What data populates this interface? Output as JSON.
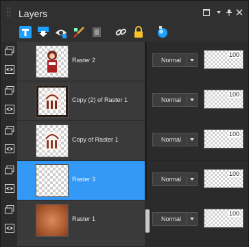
{
  "panel": {
    "title": "Layers"
  },
  "toolbar": {
    "icons": [
      "new-raster-layer-icon",
      "merge-down-icon",
      "visibility-toggle-icon",
      "paint-brush-icon",
      "mask-icon",
      "link-icon",
      "lock-icon",
      "blend-mode-icon"
    ]
  },
  "layers": [
    {
      "name": "Raster 2",
      "blend": "Normal",
      "opacity": "100",
      "selected": false,
      "thumb": "figure"
    },
    {
      "name": "Copy (2) of Raster 1",
      "blend": "Normal",
      "opacity": "100",
      "selected": false,
      "thumb": "frame"
    },
    {
      "name": "Copy of Raster 1",
      "blend": "Normal",
      "opacity": "100",
      "selected": false,
      "thumb": "frame-light"
    },
    {
      "name": "Raster 3",
      "blend": "Normal",
      "opacity": "100",
      "selected": true,
      "thumb": "transparent"
    },
    {
      "name": "Raster 1",
      "blend": "Normal",
      "opacity": "100",
      "selected": false,
      "thumb": "gradient"
    }
  ],
  "colors": {
    "selected": "#3398f6",
    "background": "#2b2b2b",
    "accent": "#1fa0ff"
  }
}
